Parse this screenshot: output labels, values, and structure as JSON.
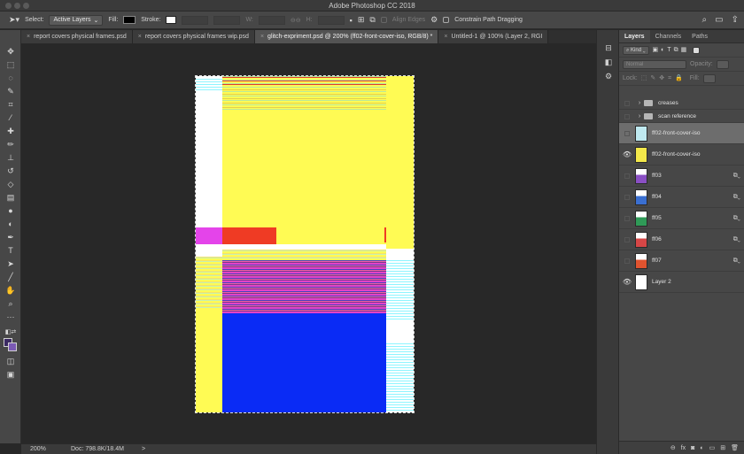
{
  "app": {
    "title": "Adobe Photoshop CC 2018"
  },
  "options_bar": {
    "select_label": "Select:",
    "select_value": "Active Layers",
    "fill_label": "Fill:",
    "stroke_label": "Stroke:",
    "w_label": "W:",
    "h_label": "H:",
    "align_edges": "Align Edges",
    "constrain": "Constrain Path Dragging"
  },
  "tabs": [
    {
      "label": "report covers physical frames.psd",
      "active": false
    },
    {
      "label": "report covers physical frames wip.psd",
      "active": false
    },
    {
      "label": "glitch-expriment.psd @ 200% (ff02-front-cover-iso, RGB/8) *",
      "active": true
    },
    {
      "label": "Untitled-1 @ 100% (Layer 2, RGI",
      "active": false
    }
  ],
  "status": {
    "zoom": "200%",
    "doc": "Doc: 798.8K/18.4M",
    "arrow": ">"
  },
  "panel": {
    "tabs": [
      "Layers",
      "Channels",
      "Paths"
    ],
    "filter": "Kind",
    "blend": "Normal",
    "opacity_label": "Opacity:",
    "lock_label": "Lock:",
    "fill_label": "Fill:",
    "layers": [
      {
        "name": "creases",
        "type": "group",
        "visible": false,
        "selected": false
      },
      {
        "name": "scan reference",
        "type": "group",
        "visible": false,
        "selected": false
      },
      {
        "name": "ff02-front-cover-iso",
        "type": "layer",
        "visible": false,
        "selected": true,
        "thumb": "#bfe9f0"
      },
      {
        "name": "ff02-front-cover-iso",
        "type": "layer",
        "visible": true,
        "selected": false,
        "thumb": "#f3e84a"
      },
      {
        "name": "ff03",
        "type": "layer",
        "visible": false,
        "selected": false,
        "thumb": "#8a4fc4",
        "fx": true
      },
      {
        "name": "ff04",
        "type": "layer",
        "visible": false,
        "selected": false,
        "thumb": "#3a6fd1",
        "fx": true
      },
      {
        "name": "ff05",
        "type": "layer",
        "visible": false,
        "selected": false,
        "thumb": "#2f9a57",
        "fx": true
      },
      {
        "name": "ff06",
        "type": "layer",
        "visible": false,
        "selected": false,
        "thumb": "#d64646",
        "fx": true
      },
      {
        "name": "ff07",
        "type": "layer",
        "visible": false,
        "selected": false,
        "thumb": "#e0532f",
        "fx": true
      },
      {
        "name": "Layer 2",
        "type": "layer",
        "visible": true,
        "selected": false,
        "thumb": "#ffffff"
      }
    ]
  },
  "colors": {
    "foreground": "#3b2a63",
    "background": "#7b5ab4"
  }
}
